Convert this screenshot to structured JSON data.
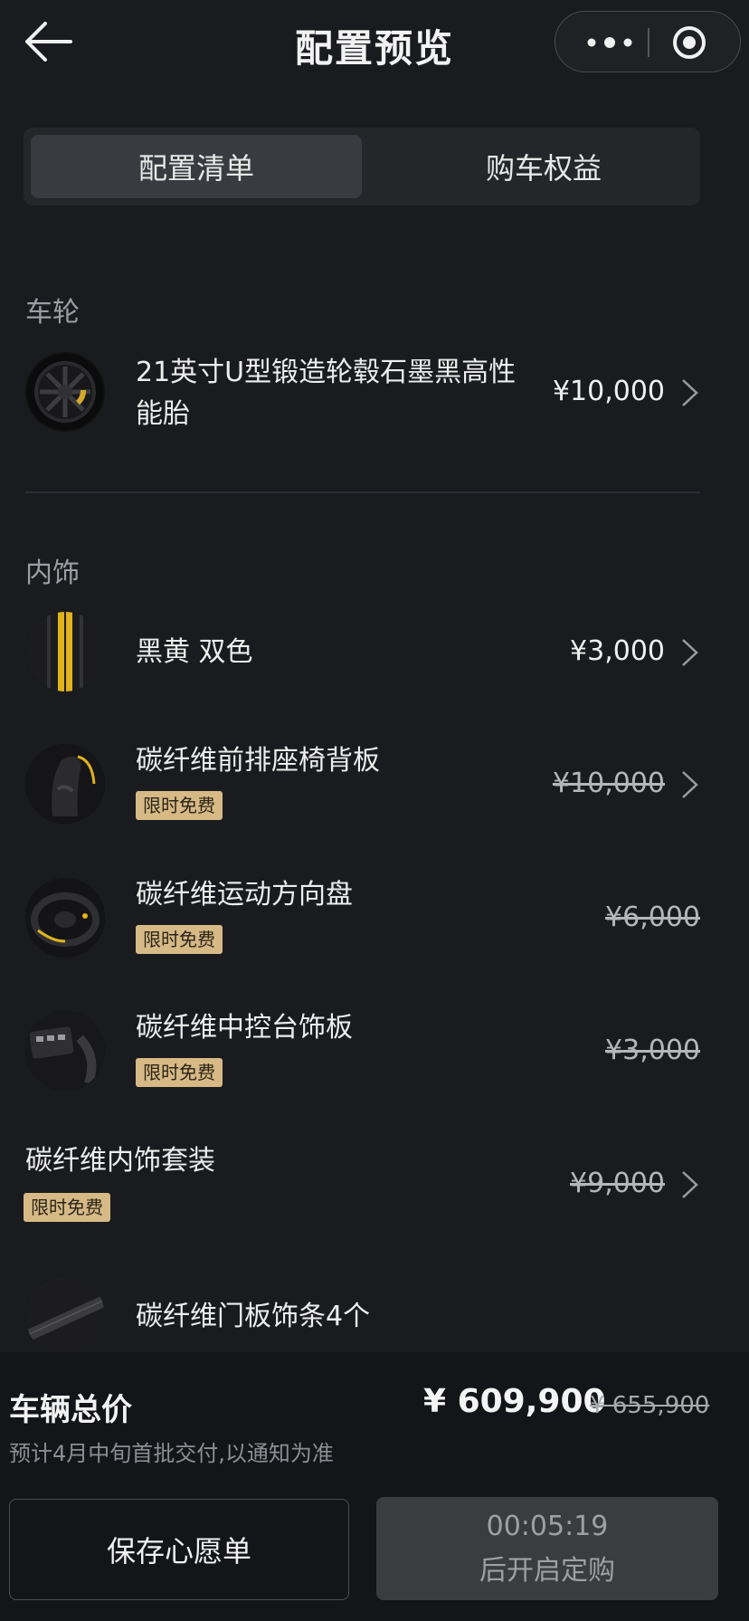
{
  "header": {
    "title": "配置预览"
  },
  "tabs": [
    {
      "label": "配置清单"
    },
    {
      "label": "购车权益"
    }
  ],
  "sections": [
    {
      "title": "车轮",
      "items": [
        {
          "name": "21英寸U型锻造轮毂石墨黑高性能胎",
          "name_line1": "21英寸U型锻造轮毂石墨黑高性",
          "name_line2": "能胎",
          "price": "¥10,000"
        }
      ]
    },
    {
      "title": "内饰",
      "items": [
        {
          "name": "黑黄 双色",
          "price": "¥3,000"
        },
        {
          "name": "碳纤维前排座椅背板",
          "badge": "限时免费",
          "price": "¥10,000"
        },
        {
          "name": "碳纤维运动方向盘",
          "badge": "限时免费",
          "price": "¥6,000"
        },
        {
          "name": "碳纤维中控台饰板",
          "badge": "限时免费",
          "price": "¥3,000"
        },
        {
          "name": "碳纤维内饰套装",
          "badge": "限时免费",
          "price": "¥9,000"
        },
        {
          "name": "碳纤维门板饰条4个"
        }
      ]
    }
  ],
  "footer": {
    "total_label": "车辆总价",
    "total_price": "¥ 609,900",
    "original_price": "¥ 655,900",
    "delivery_note": "预计4月中旬首批交付,以通知为准",
    "save_button": "保存心愿单",
    "countdown": "00:05:19",
    "order_button_sub": "后开启定购"
  },
  "colors": {
    "background": "#1a1b1e",
    "badge": "#d6b985",
    "accent_yellow": "#e0b21c"
  }
}
